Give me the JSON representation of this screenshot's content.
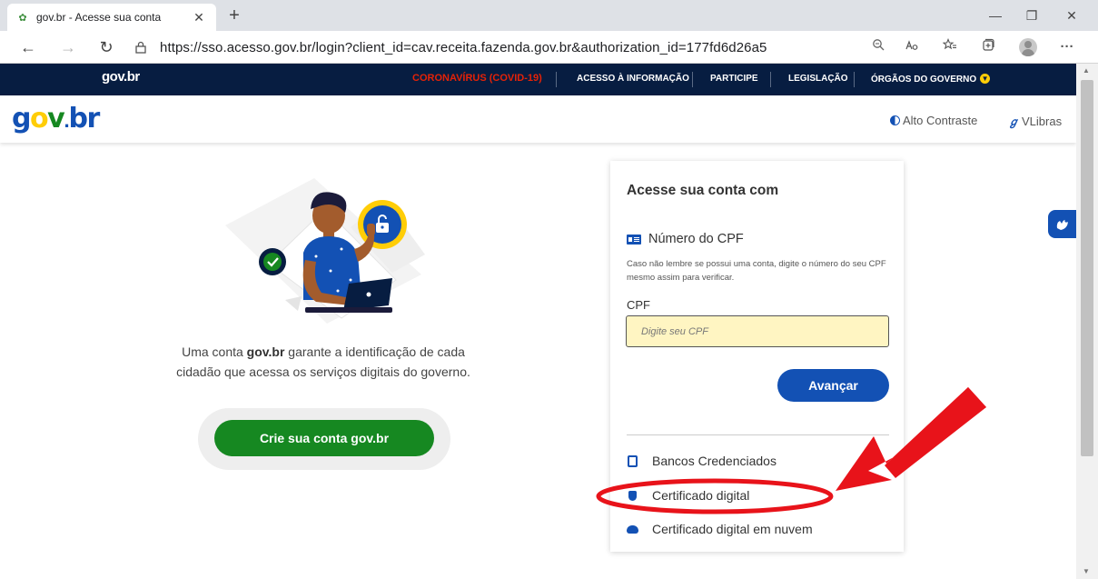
{
  "browser": {
    "tab_title": "gov.br - Acesse sua conta",
    "tab_close": "✕",
    "new_tab": "+",
    "url": "https://sso.acesso.gov.br/login?client_id=cav.receita.fazenda.gov.br&authorization_id=177fd6d26a5",
    "minimize": "—",
    "maximize": "❐",
    "close": "✕",
    "back": "←",
    "forward": "→",
    "reload": "↻",
    "more": "···"
  },
  "gov_strip": {
    "logo": "gov.br",
    "links": [
      "CORONAVÍRUS (COVID-19)",
      "ACESSO À INFORMAÇÃO",
      "PARTICIPE",
      "LEGISLAÇÃO",
      "ÓRGÃOS DO GOVERNO"
    ]
  },
  "header": {
    "brand": {
      "g": "g",
      "o": "o",
      "v": "v",
      "dot": ".",
      "br": "br"
    },
    "contrast": "Alto Contraste",
    "vlibras": "VLibras"
  },
  "intro": {
    "prefix": "Uma conta ",
    "bold": "gov.br",
    "suffix": " garante a identificação de cada cidadão que acessa os serviços digitais do governo."
  },
  "create_button": "Crie sua conta gov.br",
  "login": {
    "title": "Acesse sua conta com",
    "cpf_section": "Número do CPF",
    "hint": "Caso não lembre se possui uma conta, digite o número do seu CPF mesmo assim para verificar.",
    "cpf_label": "CPF",
    "cpf_placeholder": "Digite seu CPF",
    "next_button": "Avançar",
    "options": [
      {
        "label": "Bancos Credenciados",
        "icon": "bank-icon"
      },
      {
        "label": "Certificado digital",
        "icon": "shield-icon"
      },
      {
        "label": "Certificado digital em nuvem",
        "icon": "cloud-icon"
      }
    ]
  },
  "colors": {
    "gov_blue": "#1351b4",
    "gov_dark": "#071d41",
    "gov_green": "#168821",
    "gov_yellow": "#ffcd07",
    "covid_red": "#e52207",
    "annotation_red": "#e8131a"
  }
}
